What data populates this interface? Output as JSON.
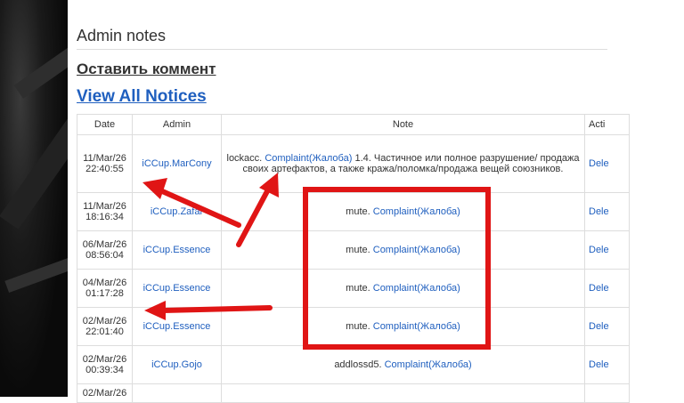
{
  "page": {
    "section_title": "Admin notes",
    "leave_comment": "Оставить коммент",
    "view_all": "View All Notices"
  },
  "table": {
    "headers": [
      "Date",
      "Admin",
      "Note",
      "Acti"
    ],
    "rows": [
      {
        "date": "11/Mar/26 22:40:55",
        "admin": "iCCup.MarCony",
        "note_prefix": "lockacc.",
        "note_link": "Complaint(Жалоба)",
        "note_suffix": "1.4. Частичное или полное разрушение/ продажа своих артефактов, а также кража/поломка/продажа вещей союзников.",
        "action": "Dele"
      },
      {
        "date": "11/Mar/26 18:16:34",
        "admin": "iCCup.Zafar",
        "note_prefix": "mute.",
        "note_link": "Complaint(Жалоба)",
        "note_suffix": "",
        "action": "Dele"
      },
      {
        "date": "06/Mar/26 08:56:04",
        "admin": "iCCup.Essence",
        "note_prefix": "mute.",
        "note_link": "Complaint(Жалоба)",
        "note_suffix": "",
        "action": "Dele"
      },
      {
        "date": "04/Mar/26 01:17:28",
        "admin": "iCCup.Essence",
        "note_prefix": "mute.",
        "note_link": "Complaint(Жалоба)",
        "note_suffix": "",
        "action": "Dele"
      },
      {
        "date": "02/Mar/26 22:01:40",
        "admin": "iCCup.Essence",
        "note_prefix": "mute.",
        "note_link": "Complaint(Жалоба)",
        "note_suffix": "",
        "action": "Dele"
      },
      {
        "date": "02/Mar/26 00:39:34",
        "admin": "iCCup.Gojo",
        "note_prefix": "addlossd5.",
        "note_link": "Complaint(Жалоба)",
        "note_suffix": "",
        "action": "Dele"
      },
      {
        "date": "02/Mar/26",
        "admin": "",
        "note_prefix": "",
        "note_link": "",
        "note_suffix": "",
        "action": ""
      }
    ]
  },
  "colors": {
    "link": "#1f5fbf",
    "annotation": "#e01515"
  }
}
